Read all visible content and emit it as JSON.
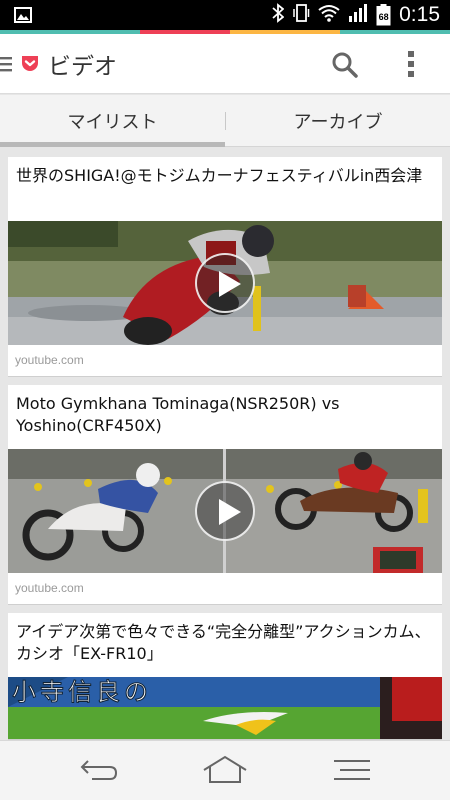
{
  "status_bar": {
    "time": "0:15",
    "battery_percent": "68",
    "icons": [
      "image-notification-icon",
      "bluetooth-icon",
      "vibrate-icon",
      "wifi-icon",
      "signal-icon",
      "battery-icon"
    ]
  },
  "app_bar": {
    "title": "ビデオ",
    "icons": [
      "menu-icon",
      "pocket-logo-icon",
      "search-icon",
      "overflow-menu-icon"
    ],
    "accent_color": "#ee4056"
  },
  "tabs": [
    {
      "label": "マイリスト",
      "selected": true
    },
    {
      "label": "アーカイブ",
      "selected": false
    }
  ],
  "feed": [
    {
      "title": "世界のSHIGA!@モトジムカーナフェスティバルin西会津",
      "domain": "youtube.com"
    },
    {
      "title": "Moto Gymkhana Tominaga(NSR250R) vs Yoshino(CRF450X)",
      "domain": "youtube.com"
    },
    {
      "title": "アイデア次第で色々できる“完全分離型”アクションカム、カシオ「EX-FR10」",
      "thumbnail_text": "小寺信良の"
    }
  ],
  "nav_bar": {
    "icons": [
      "back-icon",
      "home-icon",
      "recents-icon"
    ]
  }
}
